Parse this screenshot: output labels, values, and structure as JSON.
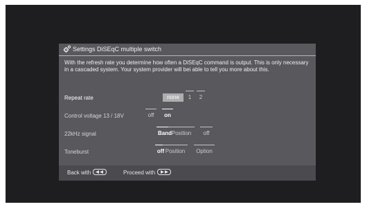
{
  "dialog": {
    "title": "Settings DiSEqC multiple switch",
    "description": "With the refresh rate you determine how often a DiSEqC command is output. This is only necessary in a cascaded system. Your system provider will bei able to tell you more about this."
  },
  "settings": [
    {
      "label": "Repeat rate",
      "active": true,
      "options": [
        "none",
        "1",
        "2"
      ],
      "selected": "none"
    },
    {
      "label": "Control voltage 13 / 18V",
      "active": false,
      "options": [
        "off",
        "on"
      ],
      "selected": "on"
    },
    {
      "label": "22kHz signal",
      "active": false,
      "options": [
        "Band",
        "Position",
        "off"
      ],
      "selected": "Band"
    },
    {
      "label": "Toneburst",
      "active": false,
      "options": [
        "off",
        "Position",
        "Option"
      ],
      "selected": "off"
    }
  ],
  "footer": {
    "back_label": "Back with",
    "back_icon": "rewind-key-icon",
    "proceed_label": "Proceed with",
    "proceed_icon": "fast-forward-key-icon"
  },
  "colors": {
    "screen_background": "#1e1e21",
    "dialog_background": "#58585d",
    "focus_highlight": "#aeaeae",
    "footer_background": "#4a4a4f"
  }
}
